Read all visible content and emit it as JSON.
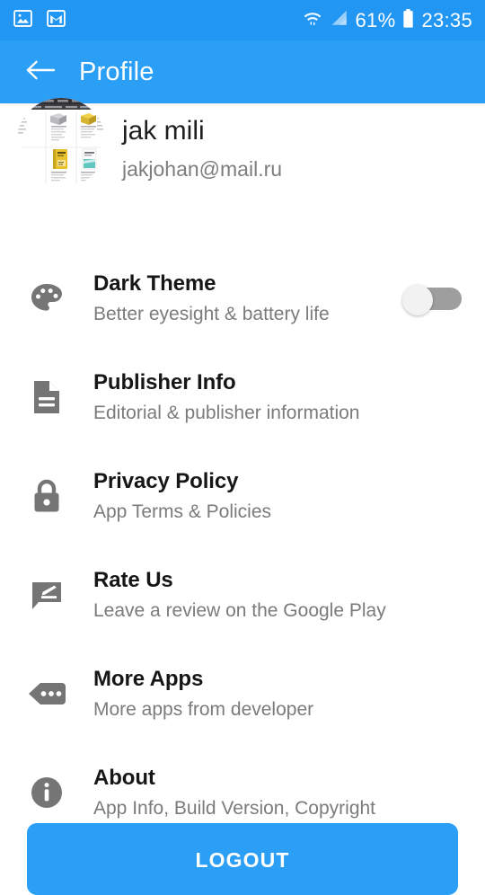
{
  "status_bar": {
    "left_icons": [
      "image-icon",
      "gmail-icon"
    ],
    "right_icons": [
      "wifi-icon",
      "cell-signal-icon",
      "battery-icon"
    ],
    "battery_percent": "61%",
    "time": "23:35"
  },
  "app_bar": {
    "back_icon": "arrow-left-icon",
    "title": "Profile"
  },
  "profile": {
    "avatar_icon": "avatar-image",
    "name": "jak mili",
    "email": "jakjohan@mail.ru"
  },
  "settings": [
    {
      "icon": "palette-icon",
      "title": "Dark Theme",
      "subtitle": "Better eyesight & battery life",
      "control": "toggle",
      "toggle_on": false
    },
    {
      "icon": "document-icon",
      "title": "Publisher Info",
      "subtitle": "Editorial & publisher information",
      "control": "none"
    },
    {
      "icon": "lock-icon",
      "title": "Privacy Policy",
      "subtitle": "App Terms & Policies",
      "control": "none"
    },
    {
      "icon": "review-pencil-icon",
      "title": "Rate Us",
      "subtitle": "Leave a review on the Google Play",
      "control": "none"
    },
    {
      "icon": "more-apps-tag-icon",
      "title": "More Apps",
      "subtitle": "More apps from developer",
      "control": "none"
    },
    {
      "icon": "info-circle-icon",
      "title": "About",
      "subtitle": "App Info, Build Version, Copyright",
      "control": "none"
    }
  ],
  "logout": {
    "label": "LOGOUT"
  },
  "colors": {
    "status_bar_blue": "#2196f3",
    "app_bar_blue": "#2b9ef5",
    "accent_blue": "#2b9ef5",
    "icon_gray": "#757575",
    "title_dark": "#161616",
    "subtitle_gray": "#7b7b7b",
    "toggle_track_off": "#9e9e9e",
    "toggle_knob": "#f2f2f2",
    "page_background": "#ffffff"
  }
}
